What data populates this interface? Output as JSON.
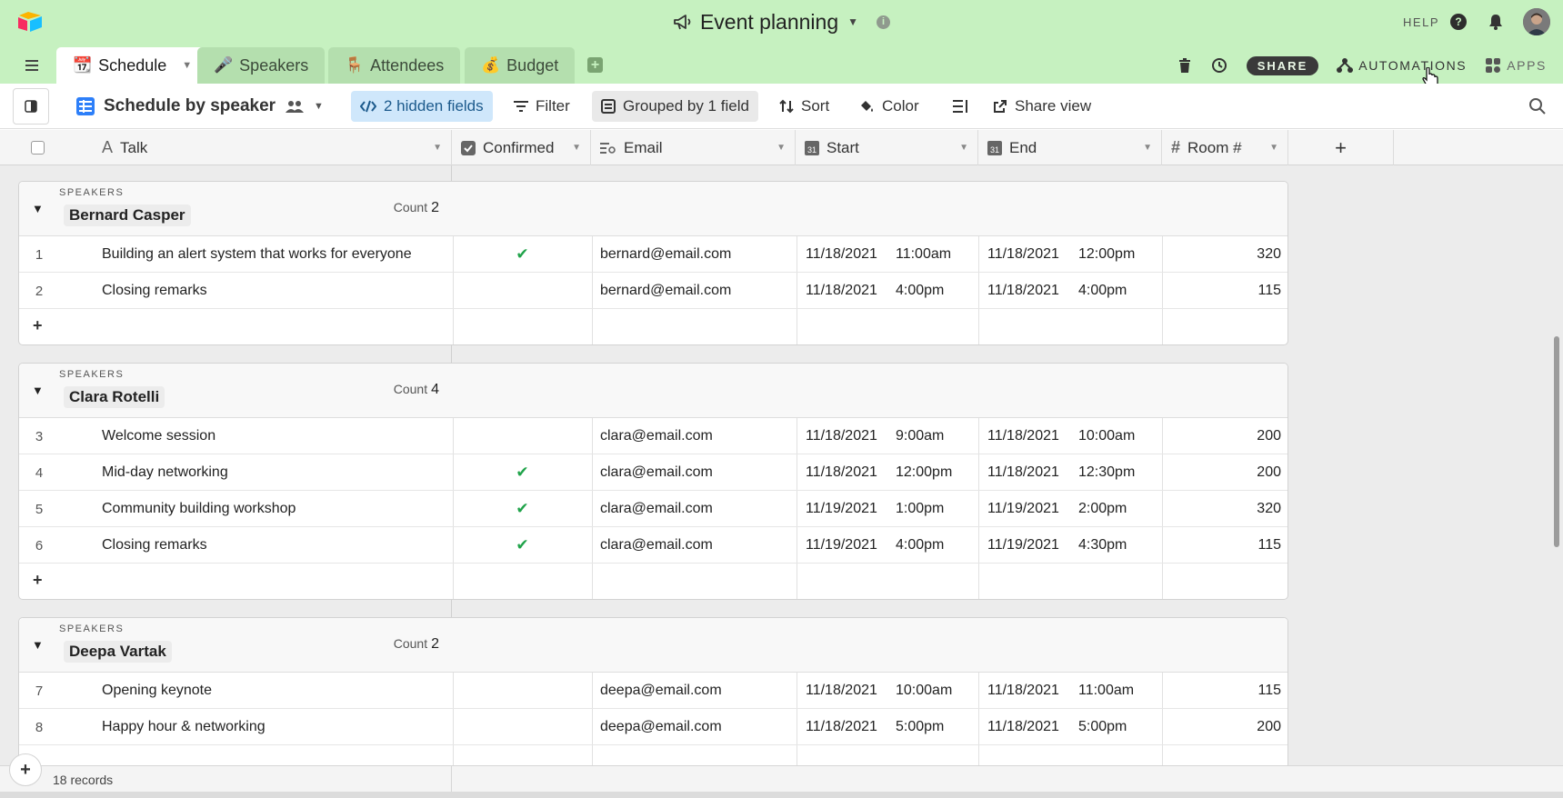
{
  "base": {
    "title": "Event planning"
  },
  "header": {
    "help_label": "HELP",
    "help_icon": "?"
  },
  "tabs": [
    {
      "label": "Schedule",
      "icon": "📆",
      "active": true
    },
    {
      "label": "Speakers",
      "icon": "🎤"
    },
    {
      "label": "Attendees",
      "icon": "🪑"
    },
    {
      "label": "Budget",
      "icon": "💰"
    }
  ],
  "actions": {
    "share": "SHARE",
    "automations": "AUTOMATIONS",
    "apps": "APPS"
  },
  "view": {
    "name": "Schedule by speaker",
    "hidden_fields": "2 hidden fields",
    "filter": "Filter",
    "grouped": "Grouped by 1 field",
    "sort": "Sort",
    "color": "Color",
    "share_view": "Share view"
  },
  "columns": {
    "talk": "Talk",
    "confirmed": "Confirmed",
    "email": "Email",
    "start": "Start",
    "end": "End",
    "room": "Room #",
    "add": "+"
  },
  "groups": [
    {
      "field_label": "SPEAKERS",
      "name": "Bernard Casper",
      "count_label": "Count",
      "count": "2",
      "rows": [
        {
          "num": "1",
          "talk": "Building an alert system that works for everyone",
          "confirmed": "✔",
          "email": "bernard@email.com",
          "start_date": "11/18/2021",
          "start_time": "11:00am",
          "end_date": "11/18/2021",
          "end_time": "12:00pm",
          "room": "320"
        },
        {
          "num": "2",
          "talk": "Closing remarks",
          "confirmed": "",
          "email": "bernard@email.com",
          "start_date": "11/18/2021",
          "start_time": "4:00pm",
          "end_date": "11/18/2021",
          "end_time": "4:00pm",
          "room": "115"
        }
      ]
    },
    {
      "field_label": "SPEAKERS",
      "name": "Clara Rotelli",
      "count_label": "Count",
      "count": "4",
      "rows": [
        {
          "num": "3",
          "talk": "Welcome session",
          "confirmed": "",
          "email": "clara@email.com",
          "start_date": "11/18/2021",
          "start_time": "9:00am",
          "end_date": "11/18/2021",
          "end_time": "10:00am",
          "room": "200"
        },
        {
          "num": "4",
          "talk": "Mid-day networking",
          "confirmed": "✔",
          "email": "clara@email.com",
          "start_date": "11/18/2021",
          "start_time": "12:00pm",
          "end_date": "11/18/2021",
          "end_time": "12:30pm",
          "room": "200"
        },
        {
          "num": "5",
          "talk": "Community building workshop",
          "confirmed": "✔",
          "email": "clara@email.com",
          "start_date": "11/19/2021",
          "start_time": "1:00pm",
          "end_date": "11/19/2021",
          "end_time": "2:00pm",
          "room": "320"
        },
        {
          "num": "6",
          "talk": "Closing remarks",
          "confirmed": "✔",
          "email": "clara@email.com",
          "start_date": "11/19/2021",
          "start_time": "4:00pm",
          "end_date": "11/19/2021",
          "end_time": "4:30pm",
          "room": "115"
        }
      ]
    },
    {
      "field_label": "SPEAKERS",
      "name": "Deepa Vartak",
      "count_label": "Count",
      "count": "2",
      "rows": [
        {
          "num": "7",
          "talk": "Opening keynote",
          "confirmed": "",
          "email": "deepa@email.com",
          "start_date": "11/18/2021",
          "start_time": "10:00am",
          "end_date": "11/18/2021",
          "end_time": "11:00am",
          "room": "115"
        },
        {
          "num": "8",
          "talk": "Happy hour & networking",
          "confirmed": "",
          "email": "deepa@email.com",
          "start_date": "11/18/2021",
          "start_time": "5:00pm",
          "end_date": "11/18/2021",
          "end_time": "5:00pm",
          "room": "200"
        }
      ]
    }
  ],
  "add_row_label": "+",
  "footer": {
    "records": "18 records",
    "add": "+"
  },
  "colors": {
    "header_bg": "#c6f1c0",
    "tab_inactive": "#b4dfae",
    "hidden_fields_bg": "#cfe7fb",
    "check": "#20a34a"
  }
}
